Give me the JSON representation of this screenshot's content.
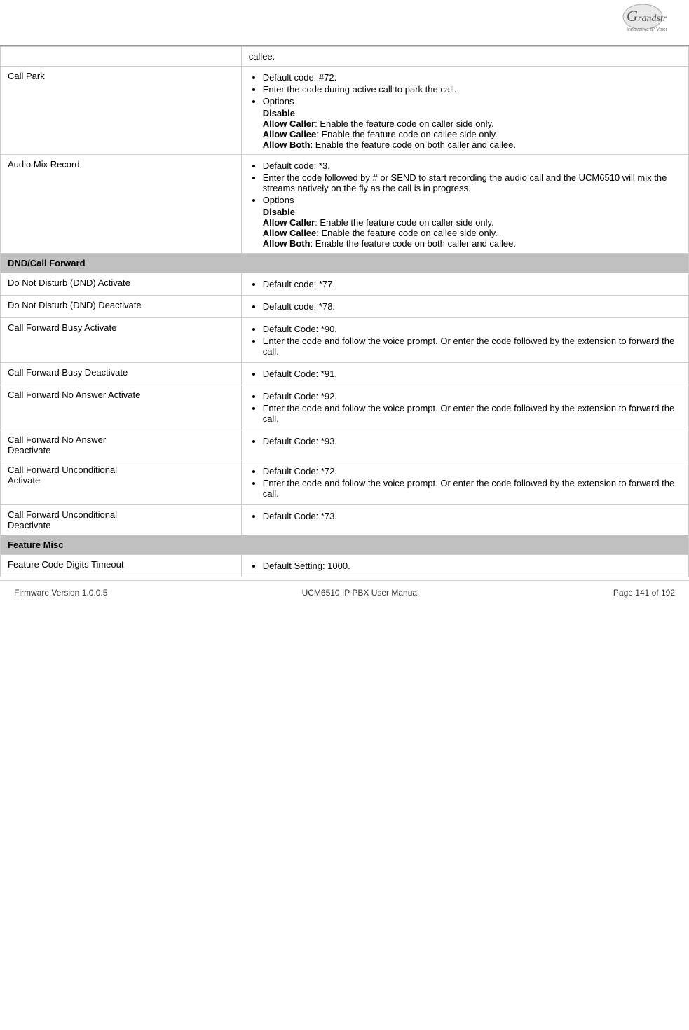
{
  "header": {
    "logo_text": "G",
    "logo_brand": "randstream",
    "logo_tagline": "Innovative IP Voice & Video"
  },
  "footer": {
    "firmware": "Firmware Version 1.0.0.5",
    "manual": "UCM6510 IP PBX User Manual",
    "page": "Page 141 of 192"
  },
  "callee_row": {
    "text": "callee."
  },
  "call_park": {
    "label": "Call Park",
    "bullets": [
      "Default code: #72.",
      "Enter the code during active call to park the call.",
      "Options"
    ],
    "options_detail": "Disable\nAllow Caller: Enable the feature code on caller side only.\nAllow Callee: Enable the feature code on callee side only.\nAllow Both: Enable the feature code on both caller and callee."
  },
  "audio_mix_record": {
    "label": "Audio Mix Record",
    "bullets": [
      "Default code: *3.",
      "Enter the code followed by # or SEND to start recording the audio call and the UCM6510 will mix the streams natively on the fly as the call is in progress.",
      "Options"
    ],
    "options_detail": "Disable\nAllow Caller: Enable the feature code on caller side only.\nAllow Callee: Enable the feature code on callee side only.\nAllow Both: Enable the feature code on both caller and callee."
  },
  "section_dnd": {
    "label": "DND/Call Forward"
  },
  "dnd_activate": {
    "label": "Do Not Disturb (DND) Activate",
    "bullet": "Default code: *77."
  },
  "dnd_deactivate": {
    "label": "Do Not Disturb (DND) Deactivate",
    "bullet": "Default code: *78."
  },
  "cf_busy_activate": {
    "label": "Call Forward Busy Activate",
    "bullets": [
      "Default Code: *90.",
      "Enter the code and follow the voice prompt. Or enter the code followed by the extension to forward the call."
    ]
  },
  "cf_busy_deactivate": {
    "label": "Call Forward Busy Deactivate",
    "bullet": "Default Code: *91."
  },
  "cf_noanswer_activate": {
    "label": "Call Forward No Answer Activate",
    "bullets": [
      "Default Code: *92.",
      "Enter the code and follow the voice prompt. Or enter the code followed by the extension to forward the call."
    ]
  },
  "cf_noanswer_deactivate": {
    "label": "Call Forward No Answer\nDeactivate",
    "bullet": "Default Code: *93."
  },
  "cf_unconditional_activate": {
    "label": "Call Forward Unconditional\nActivate",
    "bullets": [
      "Default Code: *72.",
      "Enter the code and follow the voice prompt. Or enter the code followed by the extension to forward the call."
    ]
  },
  "cf_unconditional_deactivate": {
    "label": "Call Forward Unconditional\nDeactivate",
    "bullet": "Default Code: *73."
  },
  "section_misc": {
    "label": "Feature Misc"
  },
  "feature_timeout": {
    "label": "Feature Code Digits Timeout",
    "bullet": "Default Setting: 1000."
  }
}
